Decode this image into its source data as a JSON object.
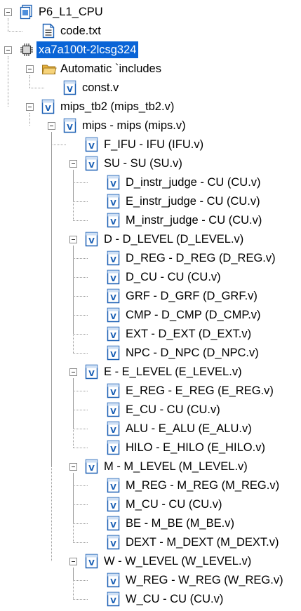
{
  "window": {
    "title": ""
  },
  "tree": [
    {
      "label": "P6_L1_CPU",
      "icon": "project-icon",
      "level": 0,
      "expanded": true,
      "name": "tree-node-project",
      "last": true
    },
    {
      "label": "code.txt",
      "icon": "text-file-icon",
      "level": 1,
      "name": "tree-node-code-txt",
      "last": true
    },
    {
      "label": "xa7a100t-2lcsg324",
      "icon": "chip-icon",
      "level": 0,
      "expanded": true,
      "selected": true,
      "name": "tree-node-device",
      "last": true
    },
    {
      "label": "Automatic `includes",
      "icon": "folder-icon",
      "level": 1,
      "expanded": true,
      "name": "tree-node-auto-includes",
      "last": false
    },
    {
      "label": "const.v",
      "icon": "verilog-file-icon",
      "level": 2,
      "name": "tree-node-const-v",
      "last": true
    },
    {
      "label": "mips_tb2 (mips_tb2.v)",
      "icon": "verilog-file-icon",
      "level": 1,
      "expanded": true,
      "name": "tree-node-mips-tb2",
      "last": true
    },
    {
      "label": "mips - mips (mips.v)",
      "icon": "verilog-file-icon",
      "level": 2,
      "expanded": true,
      "name": "tree-node-mips",
      "last": true
    },
    {
      "label": "F_IFU - IFU (IFU.v)",
      "icon": "verilog-file-icon",
      "level": 3,
      "name": "tree-node-f-ifu",
      "last": false
    },
    {
      "label": "SU - SU (SU.v)",
      "icon": "verilog-file-icon",
      "level": 3,
      "expanded": true,
      "name": "tree-node-su",
      "last": false
    },
    {
      "label": "D_instr_judge - CU (CU.v)",
      "icon": "verilog-file-icon",
      "level": 4,
      "name": "tree-node-d-instr-judge",
      "last": false
    },
    {
      "label": "E_instr_judge - CU (CU.v)",
      "icon": "verilog-file-icon",
      "level": 4,
      "name": "tree-node-e-instr-judge",
      "last": false
    },
    {
      "label": "M_instr_judge - CU (CU.v)",
      "icon": "verilog-file-icon",
      "level": 4,
      "name": "tree-node-m-instr-judge",
      "last": true
    },
    {
      "label": "D - D_LEVEL (D_LEVEL.v)",
      "icon": "verilog-file-icon",
      "level": 3,
      "expanded": true,
      "name": "tree-node-d-level",
      "last": false
    },
    {
      "label": "D_REG - D_REG (D_REG.v)",
      "icon": "verilog-file-icon",
      "level": 4,
      "name": "tree-node-d-reg",
      "last": false
    },
    {
      "label": "D_CU - CU (CU.v)",
      "icon": "verilog-file-icon",
      "level": 4,
      "name": "tree-node-d-cu",
      "last": false
    },
    {
      "label": "GRF - D_GRF (D_GRF.v)",
      "icon": "verilog-file-icon",
      "level": 4,
      "name": "tree-node-grf",
      "last": false
    },
    {
      "label": "CMP - D_CMP (D_CMP.v)",
      "icon": "verilog-file-icon",
      "level": 4,
      "name": "tree-node-cmp",
      "last": false
    },
    {
      "label": "EXT - D_EXT (D_EXT.v)",
      "icon": "verilog-file-icon",
      "level": 4,
      "name": "tree-node-ext",
      "last": false
    },
    {
      "label": "NPC - D_NPC (D_NPC.v)",
      "icon": "verilog-file-icon",
      "level": 4,
      "name": "tree-node-npc",
      "last": true
    },
    {
      "label": "E - E_LEVEL (E_LEVEL.v)",
      "icon": "verilog-file-icon",
      "level": 3,
      "expanded": true,
      "name": "tree-node-e-level",
      "last": false
    },
    {
      "label": "E_REG - E_REG (E_REG.v)",
      "icon": "verilog-file-icon",
      "level": 4,
      "name": "tree-node-e-reg",
      "last": false
    },
    {
      "label": "E_CU - CU (CU.v)",
      "icon": "verilog-file-icon",
      "level": 4,
      "name": "tree-node-e-cu",
      "last": false
    },
    {
      "label": "ALU - E_ALU (E_ALU.v)",
      "icon": "verilog-file-icon",
      "level": 4,
      "name": "tree-node-alu",
      "last": false
    },
    {
      "label": "HILO - E_HILO (E_HILO.v)",
      "icon": "verilog-file-icon",
      "level": 4,
      "name": "tree-node-hilo",
      "last": true
    },
    {
      "label": "M - M_LEVEL (M_LEVEL.v)",
      "icon": "verilog-file-icon",
      "level": 3,
      "expanded": true,
      "name": "tree-node-m-level",
      "last": false
    },
    {
      "label": "M_REG - M_REG (M_REG.v)",
      "icon": "verilog-file-icon",
      "level": 4,
      "name": "tree-node-m-reg",
      "last": false
    },
    {
      "label": "M_CU - CU (CU.v)",
      "icon": "verilog-file-icon",
      "level": 4,
      "name": "tree-node-m-cu",
      "last": false
    },
    {
      "label": "BE - M_BE (M_BE.v)",
      "icon": "verilog-file-icon",
      "level": 4,
      "name": "tree-node-be",
      "last": false
    },
    {
      "label": "DEXT - M_DEXT (M_DEXT.v)",
      "icon": "verilog-file-icon",
      "level": 4,
      "name": "tree-node-dext",
      "last": true
    },
    {
      "label": "W - W_LEVEL (W_LEVEL.v)",
      "icon": "verilog-file-icon",
      "level": 3,
      "expanded": true,
      "name": "tree-node-w-level",
      "last": true
    },
    {
      "label": "W_REG - W_REG (W_REG.v)",
      "icon": "verilog-file-icon",
      "level": 4,
      "name": "tree-node-w-reg",
      "last": false
    },
    {
      "label": "W_CU - CU (CU.v)",
      "icon": "verilog-file-icon",
      "level": 4,
      "name": "tree-node-w-cu",
      "last": true
    }
  ],
  "colors": {
    "selection": "#0a64d6",
    "verilog_icon": "#1a5fb4",
    "folder": "#e8b23c",
    "tree_line": "#9a9a9a"
  }
}
